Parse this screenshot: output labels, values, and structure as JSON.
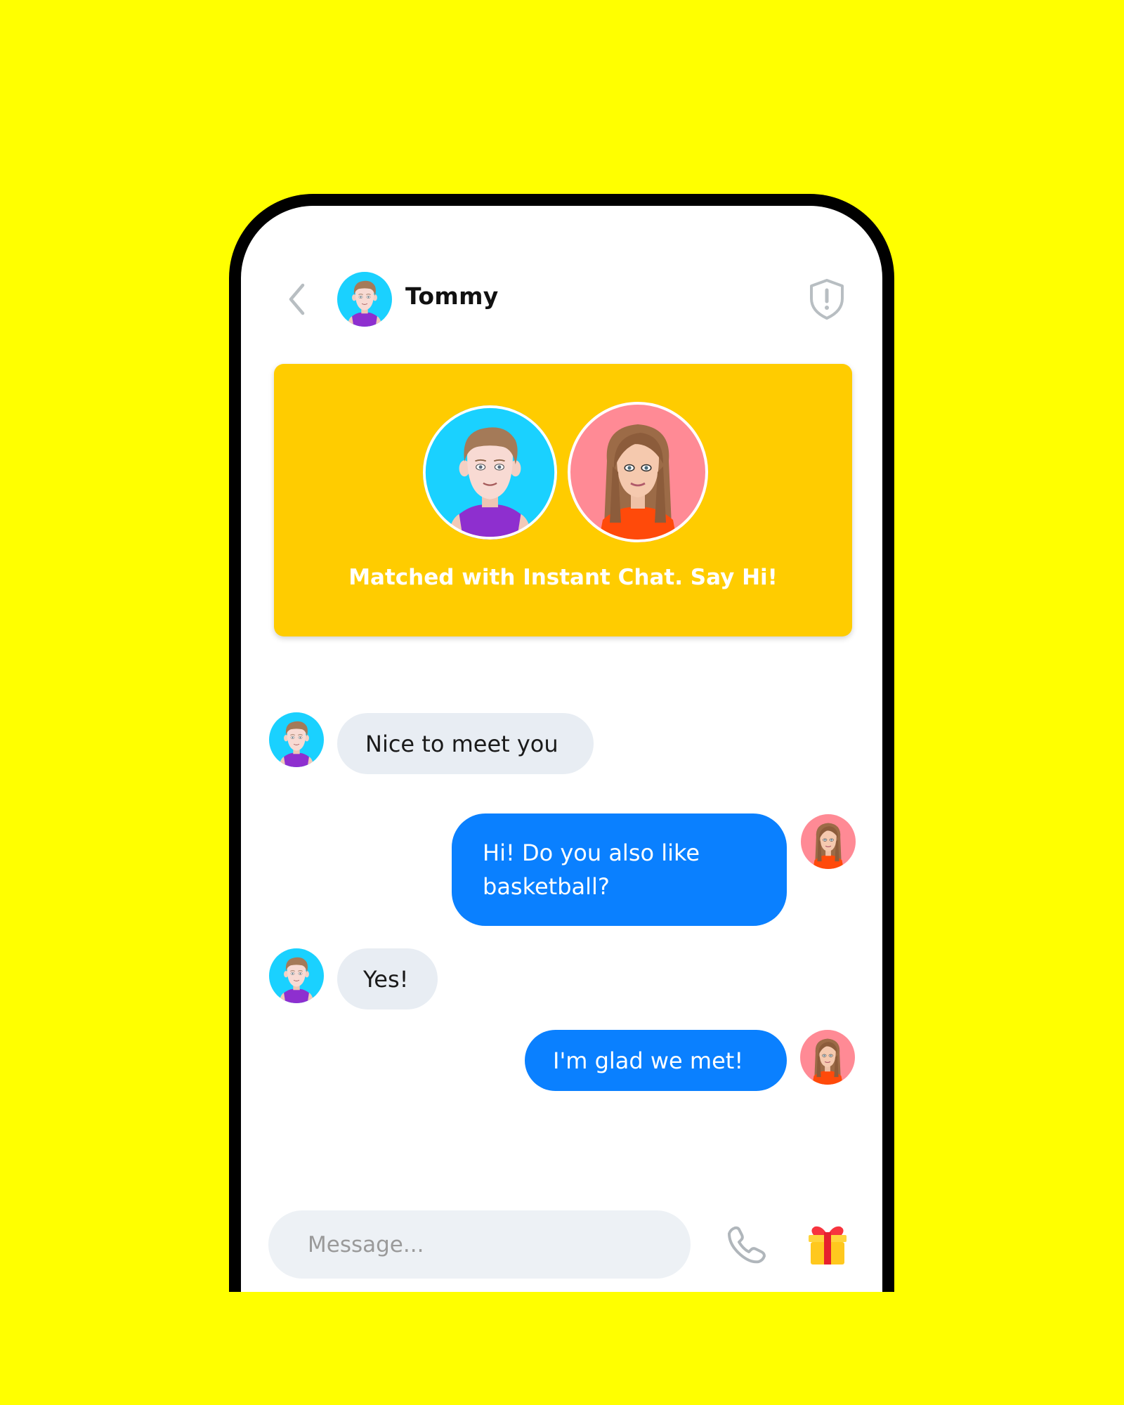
{
  "colors": {
    "background": "#FFFF00",
    "phone_frame": "#000000",
    "match_card": "#FFCC00",
    "incoming_bubble": "#E8EDF3",
    "outgoing_bubble": "#0A80FF",
    "icon_gray": "#B0B6BB"
  },
  "header": {
    "back_icon": "chevron-left-icon",
    "contact_name": "Tommy",
    "contact_avatar": "boy-avatar",
    "safety_icon": "shield-alert-icon"
  },
  "match_card": {
    "avatars": [
      "boy-avatar",
      "girl-avatar"
    ],
    "text": "Matched with Instant Chat. Say Hi!"
  },
  "messages": [
    {
      "direction": "incoming",
      "sender": "Tommy",
      "avatar": "boy-avatar",
      "text": "Nice to meet you"
    },
    {
      "direction": "outgoing",
      "sender": "me",
      "avatar": "girl-avatar",
      "text": "Hi! Do you also like basketball?"
    },
    {
      "direction": "incoming",
      "sender": "Tommy",
      "avatar": "boy-avatar",
      "text": "Yes!"
    },
    {
      "direction": "outgoing",
      "sender": "me",
      "avatar": "girl-avatar",
      "text": "I'm glad we met!"
    }
  ],
  "composer": {
    "placeholder": "Message...",
    "value": "",
    "call_icon": "phone-icon",
    "gift_icon": "gift-icon"
  }
}
